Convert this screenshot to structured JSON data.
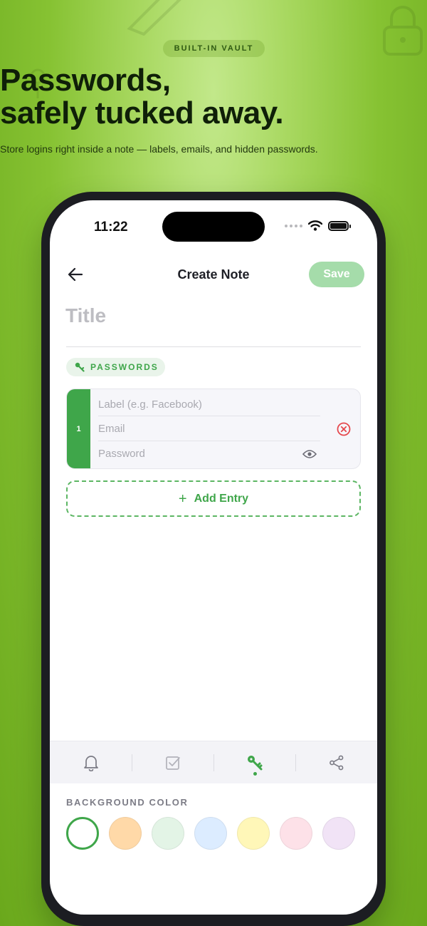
{
  "hero": {
    "badge": "BUILT-IN VAULT",
    "headline_line1": "Passwords,",
    "headline_line2": "safely tucked away.",
    "subline": "Store logins right inside a note — labels, emails, and hidden passwords."
  },
  "status_bar": {
    "time": "11:22",
    "icons": [
      "signal-dots-icon",
      "wifi-icon",
      "battery-icon"
    ]
  },
  "header": {
    "back_icon": "arrow-left-icon",
    "title": "Create Note",
    "save_label": "Save"
  },
  "note": {
    "title_placeholder": "Title",
    "section_icon": "key-icon",
    "section_label": "PASSWORDS"
  },
  "entries": [
    {
      "index": "1",
      "label_placeholder": "Label (e.g. Facebook)",
      "email_placeholder": "Email",
      "password_placeholder": "Password",
      "remove_icon": "close-circle-icon",
      "reveal_icon": "eye-icon"
    }
  ],
  "add_entry": {
    "icon": "plus-icon",
    "label": "Add Entry"
  },
  "toolbar": {
    "items": [
      {
        "icon": "bell-icon",
        "active": false
      },
      {
        "icon": "checkbox-icon",
        "active": false
      },
      {
        "icon": "key-icon",
        "active": true
      },
      {
        "icon": "share-icon",
        "active": false
      }
    ]
  },
  "background_color": {
    "label": "BACKGROUND COLOR",
    "swatches": [
      {
        "color": "#ffffff",
        "selected": true
      },
      {
        "color": "#ffd9a8",
        "selected": false
      },
      {
        "color": "#e3f4e6",
        "selected": false
      },
      {
        "color": "#dcecff",
        "selected": false
      },
      {
        "color": "#fff7b8",
        "selected": false
      },
      {
        "color": "#fde1e8",
        "selected": false
      },
      {
        "color": "#f1e3f6",
        "selected": false
      }
    ]
  },
  "colors": {
    "accent": "#3fa64a",
    "save_disabled": "#a5dcaa",
    "danger": "#e5484d"
  }
}
